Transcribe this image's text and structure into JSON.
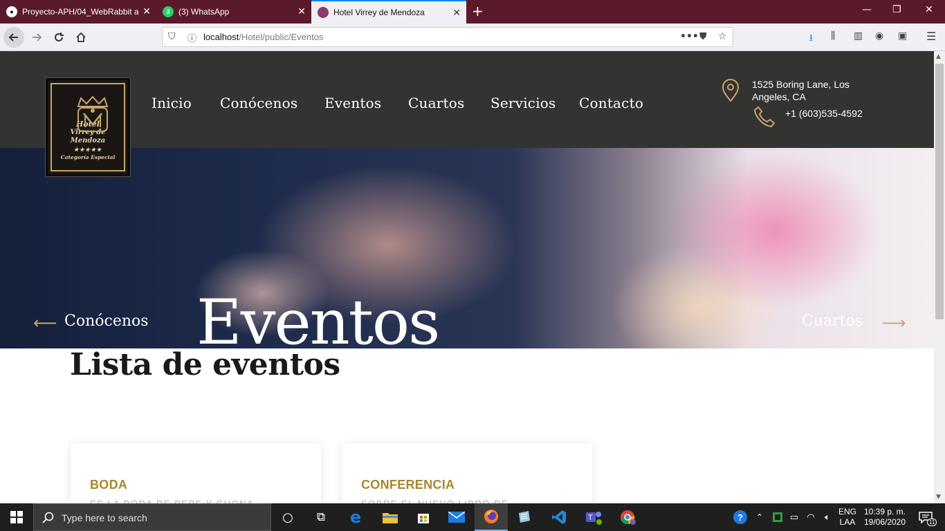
{
  "browser": {
    "tabs": [
      {
        "title": "Proyecto-APH/04_WebRabbit a",
        "icon": "github-icon",
        "active": false
      },
      {
        "title": "(3) WhatsApp",
        "icon": "whatsapp-icon",
        "badge": "3",
        "active": false
      },
      {
        "title": "Hotel Virrey de Mendoza",
        "icon": "site-favicon",
        "active": true
      }
    ],
    "url_host": "localhost",
    "url_path": "/Hotel/public/Eventos"
  },
  "site": {
    "logo": {
      "line1": "Hotel",
      "line2": "Virrey de Mendoza",
      "line3": "★★★★★",
      "line4": "Categoría Especial"
    },
    "nav": [
      "Inicio",
      "Conócenos",
      "Eventos",
      "Cuartos",
      "Servicios",
      "Contacto"
    ],
    "address_line1": "1525 Boring Lane, Los",
    "address_line2": "Angeles, CA",
    "phone": "+1 (603)535-4592"
  },
  "hero": {
    "title": "Eventos",
    "prev_label": "Conócenos",
    "next_label": "Cuartos"
  },
  "events": {
    "heading": "Lista de eventos",
    "cards": [
      {
        "title": "BODA",
        "description": "ES LA BODA DE PEPE Y CHONA"
      },
      {
        "title": "CONFERENCIA",
        "description": "SOBRE EL NUEVO LIBRO DE"
      }
    ]
  },
  "taskbar": {
    "search_placeholder": "Type here to search",
    "lang_line1": "ENG",
    "lang_line2": "LAA",
    "time": "10:39 p. m.",
    "date": "19/06/2020",
    "notifications_count": "11"
  },
  "colors": {
    "tabbar": "#5b1a2b",
    "header": "#333332",
    "accent_gold": "#c9a66b",
    "card_title": "#a8862f"
  }
}
